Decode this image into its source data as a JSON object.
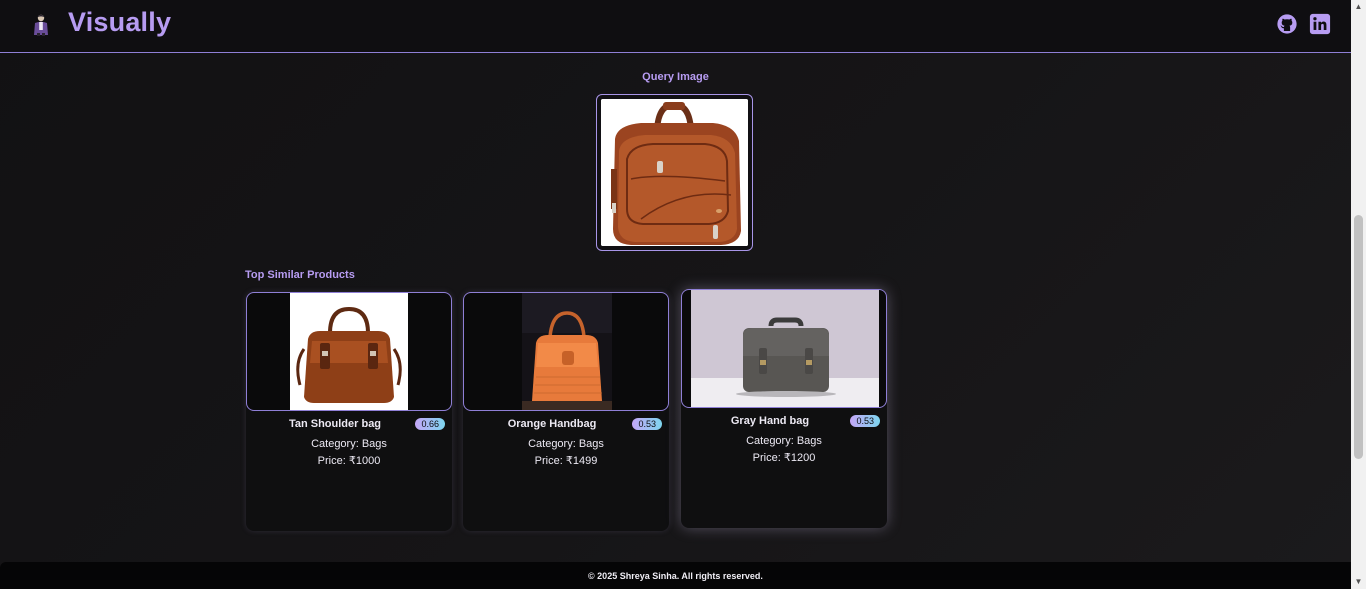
{
  "header": {
    "brand": "Visually",
    "links": [
      "github-icon",
      "linkedin-icon"
    ],
    "accent": "#b79cf2"
  },
  "query": {
    "label": "Query Image"
  },
  "results": {
    "label": "Top Similar Products",
    "items": [
      {
        "title": "Tan Shoulder bag",
        "score": "0.66",
        "category": "Category: Bags",
        "price": "Price: ₹1000"
      },
      {
        "title": "Orange Handbag",
        "score": "0.53",
        "category": "Category: Bags",
        "price": "Price: ₹1499"
      },
      {
        "title": "Gray Hand bag",
        "score": "0.53",
        "category": "Category: Bags",
        "price": "Price: ₹1200"
      }
    ]
  },
  "footer": {
    "text": "© 2025 Shreya Sinha. All rights reserved."
  }
}
